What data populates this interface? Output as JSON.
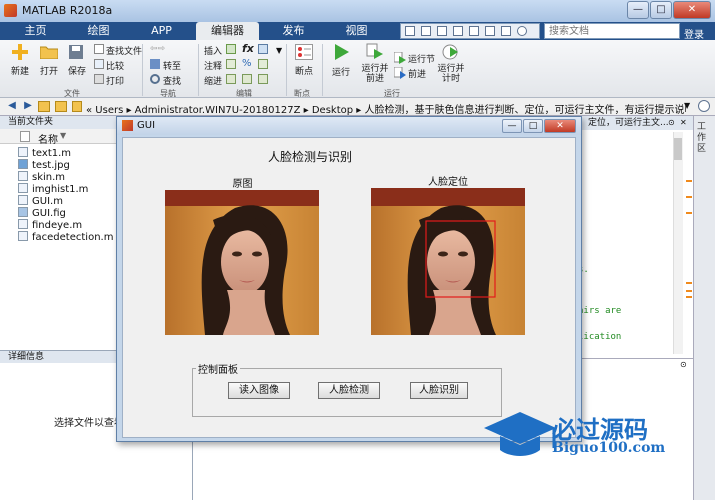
{
  "app": {
    "title": "MATLAB R2018a"
  },
  "tabs": [
    {
      "label": "主页"
    },
    {
      "label": "绘图"
    },
    {
      "label": "APP"
    },
    {
      "label": "编辑器"
    },
    {
      "label": "发布"
    },
    {
      "label": "视图"
    }
  ],
  "search": {
    "placeholder": "搜索文档"
  },
  "signin": "登录",
  "ribbon": {
    "file": {
      "new": "新建",
      "open": "打开",
      "save": "保存",
      "find_files": "查找文件",
      "compare": "比较",
      "print": "打印",
      "group": "文件"
    },
    "nav": {
      "goto": "转至",
      "find": "查找",
      "group": "导航"
    },
    "edit": {
      "insert": "插入",
      "comment": "注释",
      "indent": "缩进",
      "fx": "fx",
      "group": "编辑"
    },
    "breakpoints": {
      "label": "断点",
      "group": "断点"
    },
    "run": {
      "run": "运行",
      "run_advance": "运行并\n前进",
      "run_section": "运行节",
      "advance": "前进",
      "run_time": "运行并\n计时",
      "group": "运行"
    }
  },
  "path": {
    "text": "«  Users  ▸  Administrator.WIN7U-20180127Z  ▸  Desktop  ▸  人脸检测，基于肤色信息进行判断、定位，可运行主文件，有运行提示说明  ▸  人脸检测"
  },
  "current_folder": {
    "title": "当前文件夹",
    "column": "名称",
    "files": [
      "text1.m",
      "test.jpg",
      "skin.m",
      "imghist1.m",
      "GUI.m",
      "GUI.fig",
      "findeye.m",
      "facedetection.m"
    ]
  },
  "details": {
    "title": "详细信息",
    "empty_text": "选择文件以查看详"
  },
  "right_panel": {
    "header": "、定位，可运行主文...",
    "strip": "工作区",
    "code": [
      "s.",
      "airs are",
      "lication"
    ]
  },
  "gui": {
    "title": "GUI",
    "heading": "人脸检测与识别",
    "original_label": "原图",
    "located_label": "人脸定位",
    "panel_title": "控制面板",
    "buttons": {
      "load": "读入图像",
      "detect": "人脸检测",
      "recognize": "人脸识别"
    }
  },
  "watermark": {
    "text": "必过源码",
    "url": "Biguo100.com"
  },
  "colors": {
    "tab_bar": "#24508a",
    "face_box": "#e21b1b",
    "watermark": "#1f6fc4"
  }
}
